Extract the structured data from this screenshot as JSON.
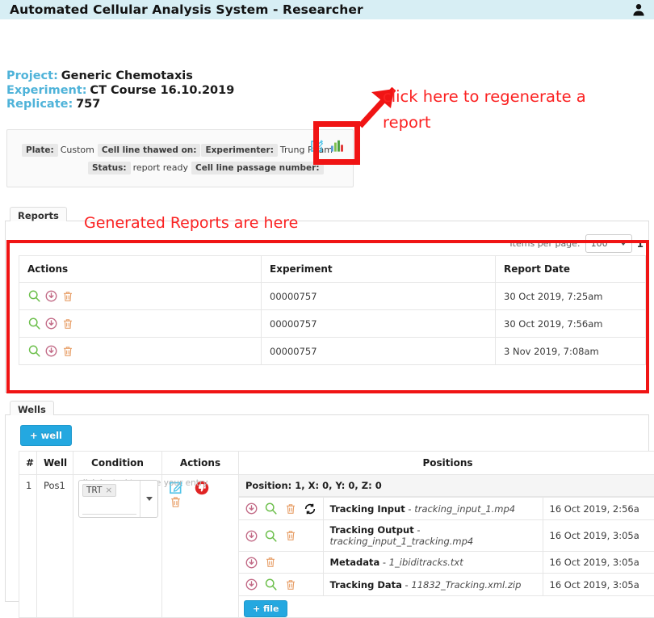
{
  "topbar": {
    "title": "Automated Cellular Analysis System - Researcher",
    "user_icon": "user-icon"
  },
  "project_info": {
    "project_label": "Project:",
    "project_value": "Generic Chemotaxis",
    "experiment_label": "Experiment:",
    "experiment_value": "CT Course 16.10.2019",
    "replicate_label": "Replicate:",
    "replicate_value": "757",
    "label_color": "#4fb3d9"
  },
  "meta_panel": {
    "plate_label": "Plate:",
    "plate_value": "Custom",
    "cell_line_thawed_label": "Cell line thawed on:",
    "experimenter_label": "Experimenter:",
    "experimenter_value": "Trung Pham",
    "status_label": "Status:",
    "status_value": "report ready",
    "cell_line_passage_label": "Cell line passage number:",
    "edit_icon": "edit-outline-icon",
    "report_icon": "bar-chart-icon"
  },
  "annotations": {
    "regenerate_note": "click here to regenerate a report",
    "generated_reports_note": "Generated Reports are here",
    "color": "#fb2222"
  },
  "reports": {
    "tab_label": "Reports",
    "items_per_page_label": "Items per page:",
    "items_per_page_value": "100",
    "page_number": "1",
    "columns": [
      "Actions",
      "Experiment",
      "Report Date"
    ],
    "action_icons": [
      "magnifier-icon",
      "download-circle-icon",
      "trash-icon"
    ],
    "rows": [
      {
        "experiment": "00000757",
        "report_date": "30 Oct 2019, 7:25am"
      },
      {
        "experiment": "00000757",
        "report_date": "30 Oct 2019, 7:56am"
      },
      {
        "experiment": "00000757",
        "report_date": "3 Nov 2019, 7:08am"
      }
    ]
  },
  "wells": {
    "tab_label": "Wells",
    "add_well_label": "+ well",
    "add_file_label": "+ file",
    "columns": [
      "#",
      "Well",
      "Condition",
      "Actions",
      "Positions"
    ],
    "row": {
      "index": "1",
      "well": "Pos1",
      "condition_placeholder": "click 'enter' to save your entry",
      "condition_chip": "TRT",
      "condition_chip_remove": "×",
      "action_icons": [
        "edit-box-icon",
        "thumbs-down-icon",
        "trash-icon"
      ]
    },
    "position_header": "Position: 1, X: 0, Y: 0, Z: 0",
    "files": [
      {
        "icons": [
          "download-circle-icon",
          "magnifier-icon",
          "trash-icon",
          "refresh-icon"
        ],
        "type": "Tracking Input",
        "separator": " - ",
        "filename": "tracking_input_1.mp4",
        "date": "16 Oct 2019, 2:56a"
      },
      {
        "icons": [
          "download-circle-icon",
          "magnifier-icon",
          "trash-icon"
        ],
        "type": "Tracking Output",
        "separator": " - ",
        "filename": "tracking_input_1_tracking.mp4",
        "date": "16 Oct 2019, 3:05a"
      },
      {
        "icons": [
          "download-circle-icon",
          "trash-icon"
        ],
        "type": "Metadata",
        "separator": " - ",
        "filename": "1_ibiditracks.txt",
        "date": "16 Oct 2019, 3:05a"
      },
      {
        "icons": [
          "download-circle-icon",
          "magnifier-icon",
          "trash-icon"
        ],
        "type": "Tracking Data",
        "separator": " - ",
        "filename": "11832_Tracking.xml.zip",
        "date": "16 Oct 2019, 3:05a"
      }
    ]
  }
}
